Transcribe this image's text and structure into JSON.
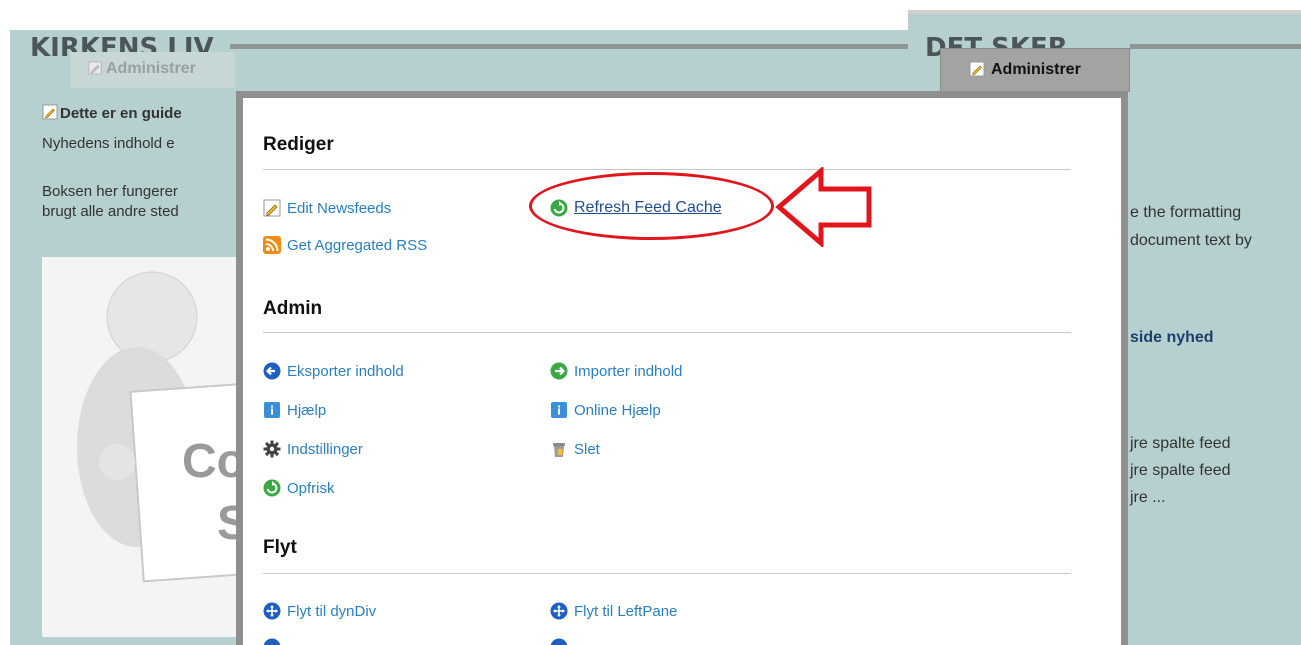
{
  "left_panel": {
    "title": "KIRKENS LIV",
    "admin_label": "Administrer",
    "line1": "Dette er en guide",
    "line2": "Nyhedens indhold e",
    "line3": "Boksen her fungerer",
    "line4": "brugt alle andre sted",
    "image_text_1": "Co",
    "image_text_2": "S"
  },
  "right_panel": {
    "title": "DET SKER",
    "admin_label": "Administrer",
    "text1": "e the formatting",
    "text2": "document text by",
    "link": "side nyhed",
    "text3": "jre spalte feed",
    "text4": "jre spalte feed",
    "text5": "jre ..."
  },
  "menu": {
    "rediger": {
      "title": "Rediger",
      "edit_newsfeeds": "Edit Newsfeeds",
      "get_rss": "Get Aggregated RSS",
      "refresh_cache": "Refresh Feed Cache"
    },
    "admin": {
      "title": "Admin",
      "eksporter": "Eksporter indhold",
      "importer": "Importer indhold",
      "hjaelp": "Hjælp",
      "online_hjaelp": "Online Hjælp",
      "indstillinger": "Indstillinger",
      "slet": "Slet",
      "opfrisk": "Opfrisk"
    },
    "flyt": {
      "title": "Flyt",
      "dyndiv": "Flyt til dynDiv",
      "leftpane": "Flyt til LeftPane"
    }
  },
  "colors": {
    "panel_bg": "#b5d0cf",
    "link_blue": "#2a7fc0",
    "callout_red": "#e0161c"
  }
}
